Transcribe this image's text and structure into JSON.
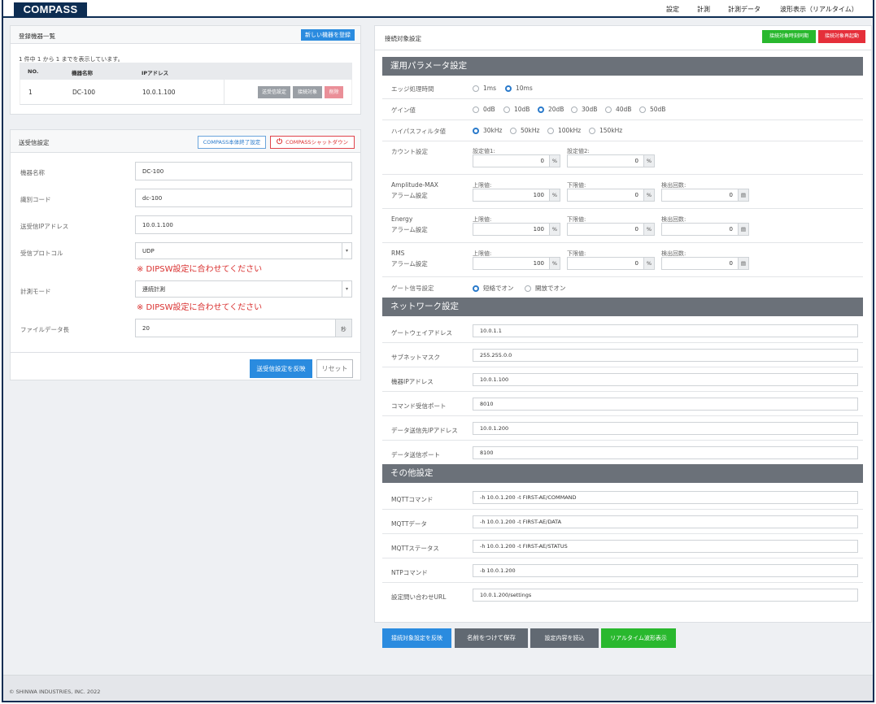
{
  "app": {
    "logo": "COMPASS"
  },
  "nav": {
    "items": [
      "設定",
      "計測",
      "計測データ",
      "波形表示（リアルタイム）"
    ]
  },
  "devices": {
    "title": "登録機器一覧",
    "new_button": "新しい機器を登録",
    "count_text": "1 件中 1 から 1 までを表示しています。",
    "columns": [
      "NO.",
      "機器名称",
      "IPアドレス"
    ],
    "rows": [
      {
        "no": "1",
        "name": "DC-100",
        "ip": "10.0.1.100"
      }
    ],
    "row_buttons": {
      "send": "送受信設定",
      "connect": "接続対象",
      "delete": "削除"
    }
  },
  "txrx": {
    "title": "送受信設定",
    "terminate_button": "COMPASS本体終了設定",
    "shutdown_button": "COMPASSシャットダウン",
    "fields": {
      "device_name": {
        "label": "機器名称",
        "value": "DC-100"
      },
      "id_code": {
        "label": "識別コード",
        "value": "dc-100"
      },
      "ip": {
        "label": "送受信IPアドレス",
        "value": "10.0.1.100"
      },
      "protocol": {
        "label": "受信プロトコル",
        "value": "UDP"
      },
      "mode": {
        "label": "計測モード",
        "value": "連続計測"
      },
      "file_len": {
        "label": "ファイルデータ長",
        "value": "20",
        "unit": "秒"
      }
    },
    "warning": "※ DIPSW設定に合わせてください",
    "apply_button": "送受信設定を反映",
    "reset_button": "リセット"
  },
  "conn": {
    "title": "接続対象設定",
    "time_sync_button": "接続対象時刻同期",
    "restart_button": "接続対象再起動",
    "op_section": "運用パラメータ設定",
    "edge": {
      "label": "エッジ処理時間",
      "options": [
        "1ms",
        "10ms"
      ],
      "selected": "10ms"
    },
    "gain": {
      "label": "ゲイン値",
      "options": [
        "0dB",
        "10dB",
        "20dB",
        "30dB",
        "40dB",
        "50dB"
      ],
      "selected": "20dB"
    },
    "hpf": {
      "label": "ハイパスフィルタ値",
      "options": [
        "30kHz",
        "50kHz",
        "100kHz",
        "150kHz"
      ],
      "selected": "30kHz"
    },
    "count": {
      "label": "カウント設定",
      "s1_label": "設定値1:",
      "s1": "0",
      "s2_label": "設定値2:",
      "s2": "0",
      "unit": "%"
    },
    "sublabels": {
      "upper": "上限値:",
      "lower": "下限値:",
      "detect": "検出回数:"
    },
    "amp": {
      "label1": "Amplitude-MAX",
      "label2": "アラーム設定",
      "upper": "100",
      "lower": "0",
      "detect": "0"
    },
    "energy": {
      "label1": "Energy",
      "label2": "アラーム設定",
      "upper": "100",
      "lower": "0",
      "detect": "0"
    },
    "rms": {
      "label1": "RMS",
      "label2": "アラーム設定",
      "upper": "100",
      "lower": "0",
      "detect": "0"
    },
    "gate": {
      "label": "ゲート信号設定",
      "options": [
        "短絡でオン",
        "開放でオン"
      ],
      "selected": "短絡でオン"
    },
    "net_section": "ネットワーク設定",
    "net": [
      {
        "label": "ゲートウェイアドレス",
        "value": "10.0.1.1"
      },
      {
        "label": "サブネットマスク",
        "value": "255.255.0.0"
      },
      {
        "label": "機器IPアドレス",
        "value": "10.0.1.100"
      },
      {
        "label": "コマンド受信ポート",
        "value": "8010"
      },
      {
        "label": "データ送信先IPアドレス",
        "value": "10.0.1.200"
      },
      {
        "label": "データ送信ポート",
        "value": "8100"
      }
    ],
    "other_section": "その他設定",
    "other": [
      {
        "label": "MQTTコマンド",
        "value": "-h 10.0.1.200 -t FIRST-AE/COMMAND"
      },
      {
        "label": "MQTTデータ",
        "value": "-h 10.0.1.200 -t FIRST-AE/DATA"
      },
      {
        "label": "MQTTステータス",
        "value": "-h 10.0.1.200 -t FIRST-AE/STATUS"
      },
      {
        "label": "NTPコマンド",
        "value": "-b 10.0.1.200"
      },
      {
        "label": "設定問い合わせURL",
        "value": "10.0.1.200/settings"
      }
    ],
    "buttons": {
      "apply": "接続対象設定を反映",
      "save_as": "名前をつけて保存",
      "load": "設定内容を読込",
      "realtime": "リアルタイム波形表示"
    }
  },
  "footer": {
    "copyright": "© SHINWA INDUSTRIES, INC. 2022"
  },
  "colors": {
    "navy": "#0d2d52",
    "blue": "#2a8bdf",
    "green": "#29b82e",
    "red": "#e52f3a",
    "section": "#6b7179"
  }
}
